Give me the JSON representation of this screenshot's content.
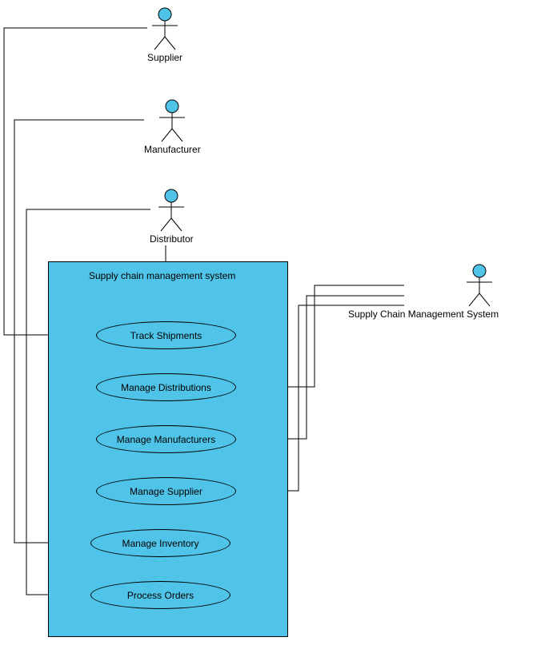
{
  "actors": {
    "supplier": "Supplier",
    "manufacturer": "Manufacturer",
    "distributor": "Distributor",
    "scms": "Supply Chain Management System"
  },
  "system": {
    "title": "Supply chain management system"
  },
  "usecases": {
    "track_shipments": "Track Shipments",
    "manage_distributions": "Manage Distributions",
    "manage_manufacturers": "Manage Manufacturers",
    "manage_supplier": "Manage Supplier",
    "manage_inventory": "Manage Inventory",
    "process_orders": "Process Orders"
  },
  "colors": {
    "actor_head": "#4FC4E8",
    "system_fill": "#4FC4E8"
  }
}
